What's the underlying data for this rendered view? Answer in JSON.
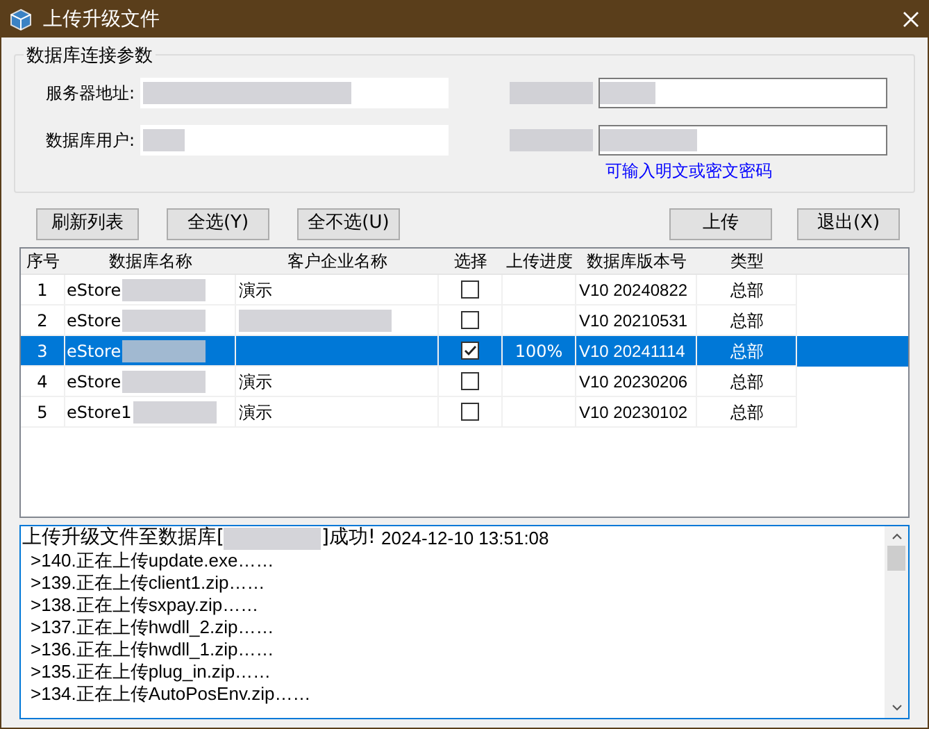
{
  "window": {
    "title": "上传升级文件"
  },
  "connection_group": {
    "title": "数据库连接参数",
    "server_label": "服务器地址:",
    "user_label": "数据库用户:",
    "password_hint": "可输入明文或密文密码"
  },
  "buttons": [
    {
      "label": "刷新列表"
    },
    {
      "label": "全选(Y)"
    },
    {
      "label": "全不选(U)"
    },
    {
      "label": "上传"
    },
    {
      "label": "退出(X)"
    }
  ],
  "table": {
    "columns": [
      "序号",
      "数据库名称",
      "客户企业名称",
      "选择",
      "上传进度",
      "数据库版本号",
      "类型"
    ],
    "rows": [
      {
        "index": "1",
        "database": "eStore",
        "company": "演示",
        "checked": false,
        "progress": "",
        "version": "V10 20240822",
        "type": "总部",
        "selected": false
      },
      {
        "index": "2",
        "database": "eStore",
        "company": "",
        "checked": false,
        "progress": "",
        "version": "V10 20210531",
        "type": "总部",
        "selected": false
      },
      {
        "index": "3",
        "database": "eStore",
        "company": "",
        "checked": true,
        "progress": "100%",
        "version": "V10 20241114",
        "type": "总部",
        "selected": true
      },
      {
        "index": "4",
        "database": "eStore",
        "company": "演示",
        "checked": false,
        "progress": "",
        "version": "V10 20230206",
        "type": "总部",
        "selected": false
      },
      {
        "index": "5",
        "database": "eStore1",
        "company": "演示",
        "checked": false,
        "progress": "",
        "version": "V10 20230102",
        "type": "总部",
        "selected": false
      }
    ]
  },
  "log": {
    "header_prefix": "上传升级文件至数据库[",
    "header_suffix": "]成功!",
    "timestamp": "2024-12-10 13:51:08",
    "lines": [
      ">140.正在上传update.exe……",
      ">139.正在上传client1.zip……",
      ">138.正在上传sxpay.zip……",
      ">137.正在上传hwdll_2.zip……",
      ">136.正在上传hwdll_1.zip……",
      ">135.正在上传plug_in.zip……",
      ">134.正在上传AutoPosEnv.zip……"
    ]
  }
}
